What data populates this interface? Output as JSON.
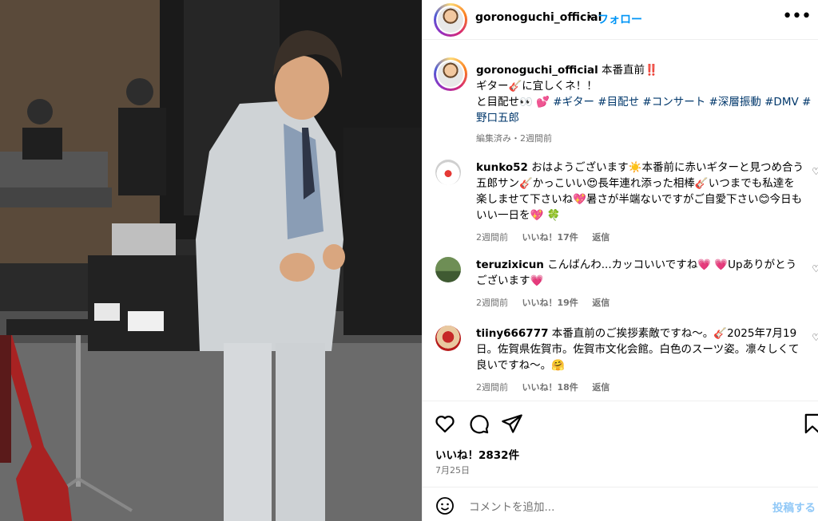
{
  "post": {
    "username": "goronoguchi_official",
    "dot": "•",
    "follow_label": "フォロー",
    "more_label": "•••"
  },
  "caption": {
    "username": "goronoguchi_official",
    "line1": "本番直前‼️",
    "line2": "ギター🎸に宜しくネ！！",
    "line3_prefix": "と目配せ👀 💕 ",
    "hashtags": "#ギター #目配せ #コンサート #深層振動 #DMV #野口五郎",
    "meta": "編集済み・2週間前"
  },
  "comments": [
    {
      "username": "kunko52",
      "text": "おはようございます☀️本番前に赤いギターと見つめ合う五郎サン🎸かっこいい😍長年連れ添った相棒🎸いつまでも私達を楽しませて下さいね💖暑さが半端ないですがご自愛下さい😊今日もいい一日を💖 🍀",
      "time": "2週間前",
      "likes": "いいね！17件",
      "reply": "返信"
    },
    {
      "username": "teruzixicun",
      "text": "こんばんわ...カッコいいですね💗 💗Upありがとうございます💗",
      "time": "2週間前",
      "likes": "いいね！19件",
      "reply": "返信"
    },
    {
      "username": "tiiny666777",
      "text": "本番直前のご挨拶素敵ですね〜。🎸2025年7月19日。佐賀県佐賀市。佐賀市文化会館。白色のスーツ姿。凛々しくて良いですね〜。🤗",
      "time": "2週間前",
      "likes": "いいね！18件",
      "reply": "返信"
    }
  ],
  "actions": {
    "likes": "いいね！2832件",
    "date": "7月25日"
  },
  "composer": {
    "placeholder": "コメントを追加...",
    "post_label": "投稿する"
  },
  "colors": {
    "link": "#0095f6",
    "hashtag": "#00376b",
    "muted": "#737373"
  }
}
